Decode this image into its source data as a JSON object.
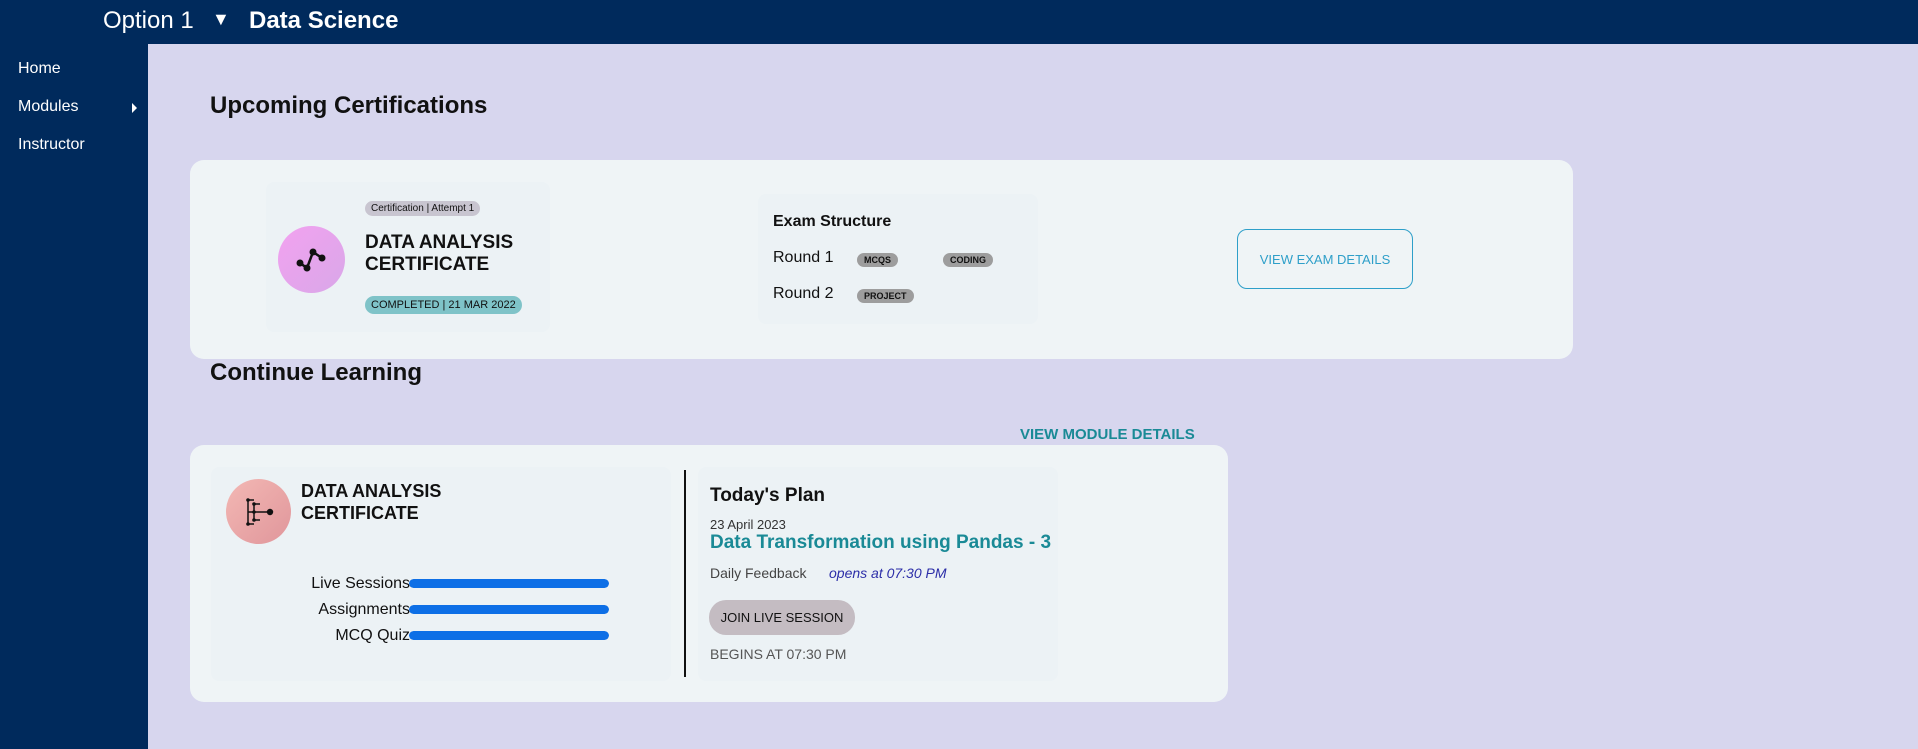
{
  "header": {
    "option_label": "Option 1",
    "dropdown_arrow": "▼",
    "title": "Data Science"
  },
  "sidebar": {
    "items": [
      {
        "label": "Home"
      },
      {
        "label": "Modules"
      },
      {
        "label": "Instructor"
      }
    ]
  },
  "upcoming": {
    "heading": "Upcoming Certifications",
    "attempt_badge": "Certification | Attempt 1",
    "cert_title_line1": "DATA ANALYSIS",
    "cert_title_line2": "CERTIFICATE",
    "status_badge": "COMPLETED | 21 MAR 2022",
    "exam_structure_title": "Exam Structure",
    "rounds": [
      {
        "label": "Round 1",
        "tags": [
          "MCQS",
          "CODING"
        ]
      },
      {
        "label": "Round 2",
        "tags": [
          "PROJECT"
        ]
      }
    ],
    "view_exam_button": "VIEW EXAM DETAILS"
  },
  "learning": {
    "heading": "Continue Learning",
    "view_module_link": "VIEW MODULE DETAILS",
    "cert_title_line1": "DATA ANALYSIS",
    "cert_title_line2": "CERTIFICATE",
    "progress": [
      {
        "label": "Live Sessions",
        "value": 1.0
      },
      {
        "label": "Assignments",
        "value": 1.0
      },
      {
        "label": "MCQ Quiz",
        "value": 1.0
      }
    ],
    "plan_title": "Today's Plan",
    "plan_date": "23 April 2023",
    "plan_topic": "Data Transformation using Pandas - 3",
    "feedback_label": "Daily Feedback",
    "feedback_opens": "opens at 07:30 PM",
    "join_button": "JOIN LIVE SESSION",
    "begins_at": "BEGINS AT 07:30 PM"
  },
  "colors": {
    "nav_bg": "#002a5c",
    "page_bg": "#d7d6ee",
    "accent_teal": "#1a8a96",
    "progress_blue": "#0d6fe6",
    "status_teal": "#7fc3c8"
  }
}
